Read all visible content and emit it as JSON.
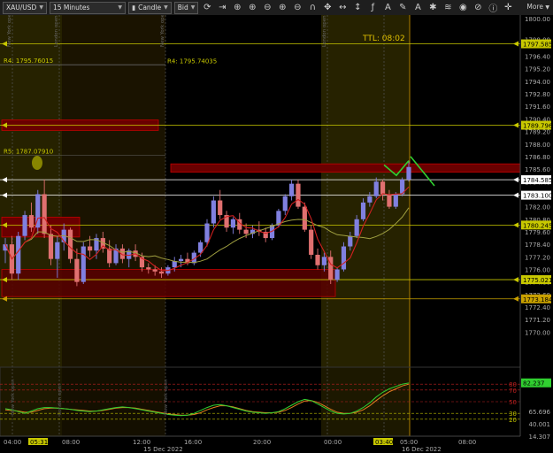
{
  "toolbar": {
    "symbol": "XAU/USD",
    "timeframe": "15 Minutes",
    "chart_type": "Candle",
    "price_side": "Bid",
    "more_label": "More",
    "icons": [
      "refresh-icon",
      "scroll-end-icon",
      "crosshair-icon",
      "zoom-in-icon",
      "zoom-out-icon",
      "zoom-in-icon",
      "zoom-out-icon",
      "magnet-icon",
      "pan-icon",
      "horizontal-resize-icon",
      "vertical-resize-icon",
      "function-icon",
      "text-icon",
      "pencil-icon",
      "text-annotation-icon",
      "settings-icon",
      "layers-icon",
      "eye-icon",
      "alert-icon",
      "info-icon",
      "crosshair-toggle-icon"
    ]
  },
  "chart_data": {
    "type": "candlestick",
    "instrument": "XAU/USD",
    "timeframe": "15 Minutes",
    "price_axis": {
      "min": 1768.0,
      "max": 1800.0,
      "ticks": [
        "1800.00",
        "1798.00",
        "1796.40",
        "1795.20",
        "1794.00",
        "1792.80",
        "1791.60",
        "1790.40",
        "1789.20",
        "1788.00",
        "1786.80",
        "1785.60",
        "1784.40",
        "1783.20",
        "1782.00",
        "1780.80",
        "1779.60",
        "1778.40",
        "1777.20",
        "1776.00",
        "1774.80",
        "1773.60",
        "1772.40",
        "1771.20",
        "1770.00"
      ],
      "tick_values": [
        1800.0,
        1798.0,
        1796.4,
        1795.2,
        1794.0,
        1792.8,
        1791.6,
        1790.4,
        1789.2,
        1788.0,
        1786.8,
        1785.6,
        1784.4,
        1783.2,
        1782.0,
        1780.8,
        1779.6,
        1778.4,
        1777.2,
        1776.0,
        1774.8,
        1773.6,
        1772.4,
        1771.2,
        1770.0
      ],
      "highlighted_labels": [
        {
          "text": "1797.585",
          "value": 1797.585,
          "color": "#c8c800"
        },
        {
          "text": "1789.796",
          "value": 1789.796,
          "color": "#c8c800"
        },
        {
          "text": "1784.585",
          "value": 1784.585,
          "color": "#ffffff"
        },
        {
          "text": "1783.100",
          "value": 1783.1,
          "color": "#ffffff"
        },
        {
          "text": "1780.245",
          "value": 1780.245,
          "color": "#c8c800"
        },
        {
          "text": "1775.021",
          "value": 1775.021,
          "color": "#c8c800"
        },
        {
          "text": "1773.184",
          "value": 1773.184,
          "color": "#c8a000"
        }
      ]
    },
    "time_axis": {
      "labels": [
        "04:00",
        "05:31",
        "08:00",
        "12:00",
        "16:00",
        "20:00",
        "00:00",
        "03:40",
        "05:00",
        "08:00"
      ],
      "dates": [
        "15 Dec 2022",
        "16 Dec 2022"
      ]
    },
    "level_labels": [
      {
        "text": "R4: 1795.76015",
        "value": 1795.76
      },
      {
        "text": "R4: 1795.74035",
        "value": 1795.74
      },
      {
        "text": "R5: 1787.07910",
        "value": 1787.08
      }
    ],
    "horizontal_lines": [
      1797.585,
      1789.796,
      1784.585,
      1783.1,
      1780.245,
      1775.021,
      1773.184
    ],
    "session_labels": [
      "New York open",
      "London open",
      "New York open",
      "London open"
    ],
    "ttl_label": "TTL: 08:02",
    "candles": [
      [
        1777.8,
        1779.0,
        1776.6,
        1778.4
      ],
      [
        1778.4,
        1779.2,
        1775.0,
        1775.6
      ],
      [
        1775.6,
        1779.6,
        1775.0,
        1779.2
      ],
      [
        1779.2,
        1781.6,
        1778.8,
        1781.2
      ],
      [
        1781.2,
        1782.4,
        1779.6,
        1780.0
      ],
      [
        1780.0,
        1783.6,
        1779.4,
        1783.2
      ],
      [
        1783.2,
        1784.6,
        1779.0,
        1779.4
      ],
      [
        1779.4,
        1780.2,
        1776.4,
        1777.0
      ],
      [
        1777.0,
        1779.2,
        1775.2,
        1778.6
      ],
      [
        1778.6,
        1780.4,
        1777.8,
        1779.8
      ],
      [
        1779.8,
        1780.0,
        1776.6,
        1777.0
      ],
      [
        1777.0,
        1778.0,
        1774.4,
        1774.8
      ],
      [
        1774.8,
        1778.6,
        1774.6,
        1778.2
      ],
      [
        1778.2,
        1779.2,
        1777.2,
        1777.8
      ],
      [
        1777.8,
        1779.4,
        1777.0,
        1779.0
      ],
      [
        1779.0,
        1779.6,
        1777.6,
        1778.0
      ],
      [
        1778.0,
        1778.8,
        1776.2,
        1776.6
      ],
      [
        1776.6,
        1778.4,
        1776.4,
        1778.0
      ],
      [
        1778.0,
        1778.4,
        1776.6,
        1777.0
      ],
      [
        1777.0,
        1778.0,
        1776.2,
        1777.8
      ],
      [
        1777.8,
        1778.4,
        1776.8,
        1777.2
      ],
      [
        1777.2,
        1777.6,
        1775.8,
        1776.2
      ],
      [
        1776.2,
        1776.6,
        1775.6,
        1776.0
      ],
      [
        1776.0,
        1776.4,
        1775.4,
        1775.8
      ],
      [
        1775.8,
        1776.2,
        1775.2,
        1775.6
      ],
      [
        1775.6,
        1776.4,
        1775.4,
        1776.2
      ],
      [
        1776.2,
        1777.2,
        1775.8,
        1776.8
      ],
      [
        1776.8,
        1777.4,
        1776.2,
        1777.0
      ],
      [
        1777.0,
        1777.6,
        1776.4,
        1776.6
      ],
      [
        1776.6,
        1777.8,
        1776.4,
        1777.6
      ],
      [
        1777.6,
        1778.8,
        1777.2,
        1778.6
      ],
      [
        1778.6,
        1780.8,
        1778.2,
        1780.4
      ],
      [
        1780.4,
        1783.0,
        1780.0,
        1782.6
      ],
      [
        1782.6,
        1783.6,
        1780.8,
        1781.2
      ],
      [
        1781.2,
        1781.6,
        1779.6,
        1780.0
      ],
      [
        1780.0,
        1781.0,
        1779.4,
        1780.8
      ],
      [
        1780.8,
        1781.4,
        1779.4,
        1779.8
      ],
      [
        1779.8,
        1780.4,
        1779.0,
        1779.4
      ],
      [
        1779.4,
        1780.2,
        1779.0,
        1779.8
      ],
      [
        1779.8,
        1780.6,
        1779.2,
        1779.6
      ],
      [
        1779.6,
        1780.0,
        1778.6,
        1779.0
      ],
      [
        1779.0,
        1780.4,
        1778.8,
        1780.2
      ],
      [
        1780.2,
        1781.8,
        1780.0,
        1781.6
      ],
      [
        1781.6,
        1783.2,
        1781.2,
        1783.0
      ],
      [
        1783.0,
        1784.6,
        1782.6,
        1784.2
      ],
      [
        1784.2,
        1784.6,
        1781.8,
        1782.0
      ],
      [
        1782.0,
        1782.4,
        1779.6,
        1779.8
      ],
      [
        1779.8,
        1780.2,
        1777.0,
        1777.4
      ],
      [
        1777.4,
        1778.0,
        1776.0,
        1776.4
      ],
      [
        1776.4,
        1777.6,
        1775.8,
        1777.2
      ],
      [
        1777.2,
        1777.8,
        1774.6,
        1775.0
      ],
      [
        1775.0,
        1776.2,
        1774.8,
        1776.0
      ],
      [
        1776.0,
        1778.6,
        1775.8,
        1778.2
      ],
      [
        1778.2,
        1779.6,
        1777.8,
        1779.2
      ],
      [
        1779.2,
        1781.2,
        1779.0,
        1780.8
      ],
      [
        1780.8,
        1782.8,
        1780.6,
        1782.4
      ],
      [
        1782.4,
        1783.4,
        1782.0,
        1783.0
      ],
      [
        1783.0,
        1784.8,
        1782.8,
        1784.4
      ],
      [
        1784.4,
        1784.6,
        1782.6,
        1783.2
      ],
      [
        1783.2,
        1783.6,
        1781.8,
        1782.0
      ],
      [
        1782.0,
        1783.4,
        1781.8,
        1783.2
      ],
      [
        1783.2,
        1784.8,
        1783.0,
        1784.6
      ],
      [
        1784.6,
        1786.4,
        1784.4,
        1785.8
      ]
    ],
    "oscillator": {
      "levels": [
        "80",
        "70",
        "50",
        "30",
        "20"
      ],
      "level_values": [
        80,
        70,
        50,
        30,
        20
      ],
      "axis_labels": [
        "65.696",
        "40.001",
        "14.307"
      ],
      "current_value_label": "82.237",
      "current_value": 82.237,
      "fast_line": [
        38,
        36,
        33,
        30,
        34,
        38,
        40,
        40,
        39,
        38,
        37,
        35,
        34,
        33,
        34,
        36,
        38,
        40,
        41,
        40,
        38,
        36,
        34,
        32,
        30,
        28,
        27,
        26,
        27,
        30,
        35,
        40,
        44,
        45,
        43,
        40,
        37,
        34,
        32,
        31,
        30,
        31,
        33,
        38,
        44,
        50,
        54,
        52,
        46,
        40,
        34,
        30,
        29,
        30,
        34,
        40,
        48,
        58,
        66,
        72,
        76,
        80,
        82
      ],
      "slow_line": [
        36,
        35,
        34,
        32,
        32,
        35,
        38,
        39,
        39,
        38,
        37,
        36,
        35,
        34,
        34,
        35,
        37,
        39,
        40,
        40,
        39,
        37,
        35,
        33,
        31,
        29,
        28,
        27,
        27,
        28,
        31,
        36,
        40,
        43,
        43,
        41,
        38,
        35,
        33,
        32,
        31,
        31,
        32,
        35,
        40,
        46,
        51,
        52,
        49,
        43,
        37,
        32,
        30,
        30,
        32,
        36,
        43,
        52,
        60,
        67,
        72,
        77,
        80
      ]
    }
  }
}
